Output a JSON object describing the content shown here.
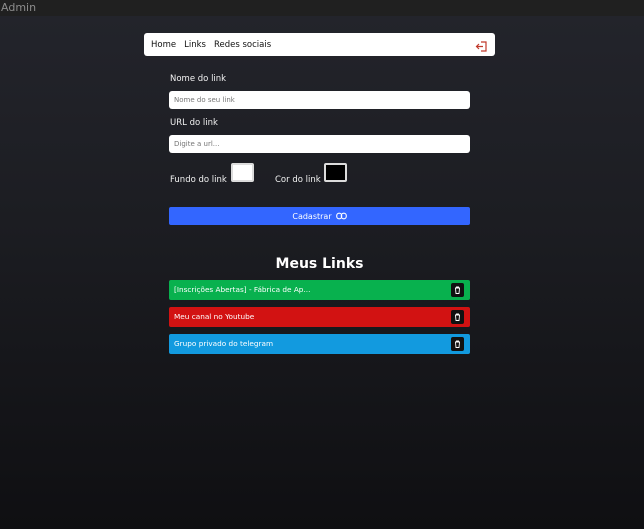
{
  "window": {
    "title": "Admin"
  },
  "nav": {
    "items": [
      "Home",
      "Links",
      "Redes sociais"
    ],
    "logout_icon": "logout-icon"
  },
  "form": {
    "name_label": "Nome do link",
    "name_placeholder": "Nome do seu link",
    "url_label": "URL do link",
    "url_placeholder": "Digite a url...",
    "bg_label": "Fundo do link",
    "bg_value": "#ffffff",
    "color_label": "Cor do link",
    "color_value": "#000000",
    "submit_label": "Cadastrar",
    "submit_icon": "link-icon"
  },
  "links_section": {
    "title": "Meus Links",
    "items": [
      {
        "label": "[Inscrições Abertas] - Fábrica de Ap...",
        "bg": "#08b14e",
        "color": "#ffffff"
      },
      {
        "label": "Meu canal no Youtube",
        "bg": "#d21212",
        "color": "#ffffff"
      },
      {
        "label": "Grupo privado do telegram",
        "bg": "#129adf",
        "color": "#ffffff"
      }
    ],
    "delete_icon": "trash-icon"
  }
}
